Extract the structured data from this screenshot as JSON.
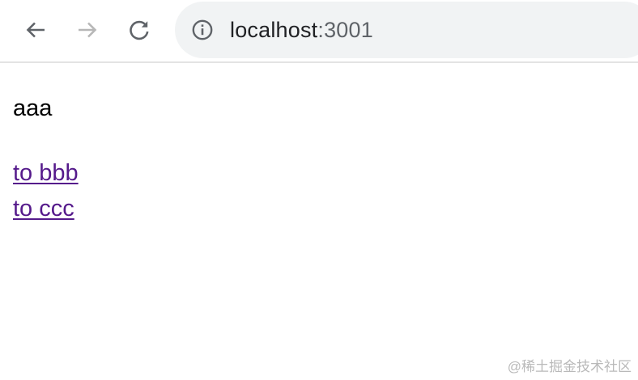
{
  "browser": {
    "back_icon": "arrow-left-icon",
    "forward_icon": "arrow-right-icon",
    "reload_icon": "reload-icon",
    "info_icon": "info-circle-icon",
    "url_host": "localhost",
    "url_port": ":3001",
    "forward_disabled": true
  },
  "page": {
    "text": "aaa",
    "links": [
      {
        "label": "to bbb"
      },
      {
        "label": "to ccc"
      }
    ],
    "link_color": "#551a8b"
  },
  "watermark": {
    "text": "@稀土掘金技术社区"
  }
}
